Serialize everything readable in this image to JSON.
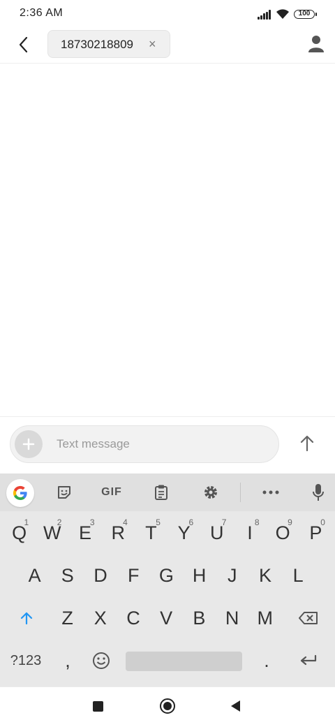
{
  "status_bar": {
    "time": "2:36 AM",
    "battery": "100"
  },
  "header": {
    "recipient": "18730218809",
    "remove_symbol": "×"
  },
  "compose": {
    "placeholder": "Text message"
  },
  "keyboard": {
    "toolbar": {
      "gif_label": "GIF"
    },
    "rows": [
      [
        {
          "k": "Q",
          "h": "1"
        },
        {
          "k": "W",
          "h": "2"
        },
        {
          "k": "E",
          "h": "3"
        },
        {
          "k": "R",
          "h": "4"
        },
        {
          "k": "T",
          "h": "5"
        },
        {
          "k": "Y",
          "h": "6"
        },
        {
          "k": "U",
          "h": "7"
        },
        {
          "k": "I",
          "h": "8"
        },
        {
          "k": "O",
          "h": "9"
        },
        {
          "k": "P",
          "h": "0"
        }
      ],
      [
        {
          "k": "A"
        },
        {
          "k": "S"
        },
        {
          "k": "D"
        },
        {
          "k": "F"
        },
        {
          "k": "G"
        },
        {
          "k": "H"
        },
        {
          "k": "J"
        },
        {
          "k": "K"
        },
        {
          "k": "L"
        }
      ],
      [
        {
          "k": "Z"
        },
        {
          "k": "X"
        },
        {
          "k": "C"
        },
        {
          "k": "V"
        },
        {
          "k": "B"
        },
        {
          "k": "N"
        },
        {
          "k": "M"
        }
      ]
    ],
    "symbols_label": "?123",
    "comma": ",",
    "period": "."
  },
  "icons": [
    "back-arrow-icon",
    "close-icon",
    "contact-icon",
    "plus-icon",
    "send-arrow-icon",
    "google-icon",
    "sticker-icon",
    "clipboard-icon",
    "gear-icon",
    "more-icon",
    "mic-icon",
    "shift-icon",
    "backspace-icon",
    "emoji-icon",
    "enter-icon",
    "nav-recents-icon",
    "nav-home-icon",
    "nav-back-icon"
  ],
  "colors": {
    "accent_shift": "#2196f3",
    "keyboard_bg": "#e8e8e8"
  }
}
